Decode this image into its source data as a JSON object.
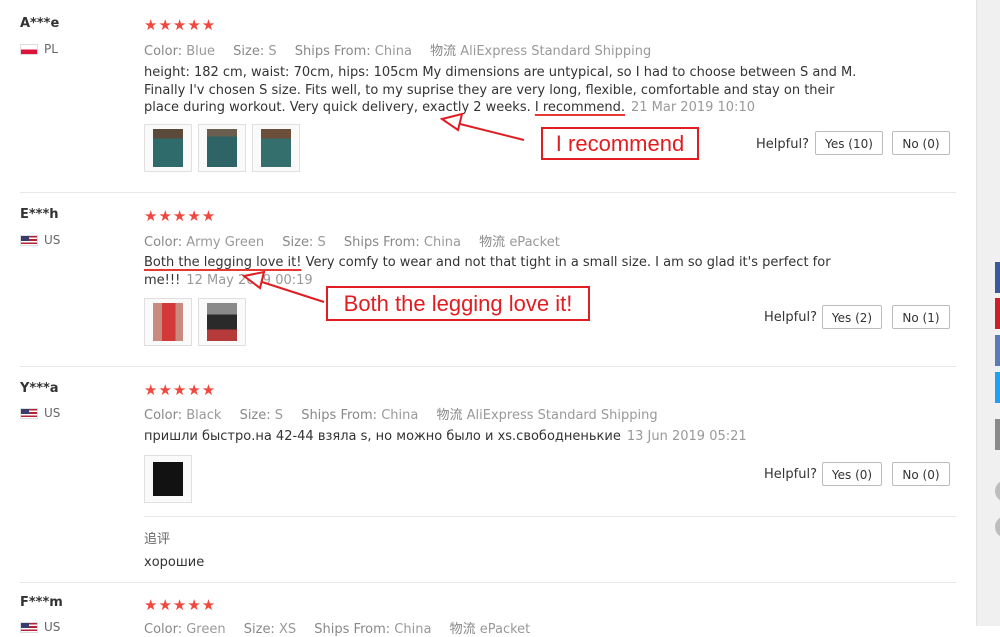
{
  "labels": {
    "color": "Color:",
    "size": "Size:",
    "ships_from": "Ships From:",
    "logistics": "物流",
    "helpful": "Helpful?"
  },
  "reviews": [
    {
      "user": "A***e",
      "country": "PL",
      "stars": "★★★★★",
      "color": "Blue",
      "size": "S",
      "ships_from": "China",
      "shipping": "AliExpress Standard Shipping",
      "text": "height: 182 cm, waist: 70cm, hips: 105cm My dimensions are untypical, so I had to choose between S and M. Finally I'v chosen S size. Fits well, to my suprise they are very long, flexible, comfortable and stay on their place during workout. Very quick delivery, exactly 2 weeks.",
      "highlight": "I recommend.",
      "date": "21 Mar 2019 10:10",
      "yes": "Yes (10)",
      "no": "No (0)"
    },
    {
      "user": "E***h",
      "country": "US",
      "stars": "★★★★★",
      "color": "Army Green",
      "size": "S",
      "ships_from": "China",
      "shipping": "ePacket",
      "highlight": "Both the legging love it!",
      "text": "Very comfy to wear and not that tight in a small size. I am so glad it's perfect for me!!!",
      "date": "12 May 2019 00:19",
      "yes": "Yes (2)",
      "no": "No (1)"
    },
    {
      "user": "Y***a",
      "country": "US",
      "stars": "★★★★★",
      "color": "Black",
      "size": "S",
      "ships_from": "China",
      "shipping": "AliExpress Standard Shipping",
      "text": "пришли быстро.на 42-44 взяла s, но можно было и xs.свободненькие",
      "date": "13 Jun 2019 05:21",
      "yes": "Yes (0)",
      "no": "No (0)",
      "followup_label": "追评",
      "followup_text": "хорошие"
    },
    {
      "user": "F***m",
      "country": "US",
      "stars": "★★★★★",
      "color": "Green",
      "size": "XS",
      "ships_from": "China",
      "shipping": "ePacket"
    }
  ],
  "annotations": {
    "callout_1": "I recommend",
    "callout_2": "Both the legging love it!"
  },
  "colors": {
    "accent": "#e11d21",
    "stars": "#f0483e",
    "share_buttons": [
      "#3b5998",
      "#cb2027",
      "#5b7bb5",
      "#1da1f2",
      "#8a8a8a"
    ]
  }
}
